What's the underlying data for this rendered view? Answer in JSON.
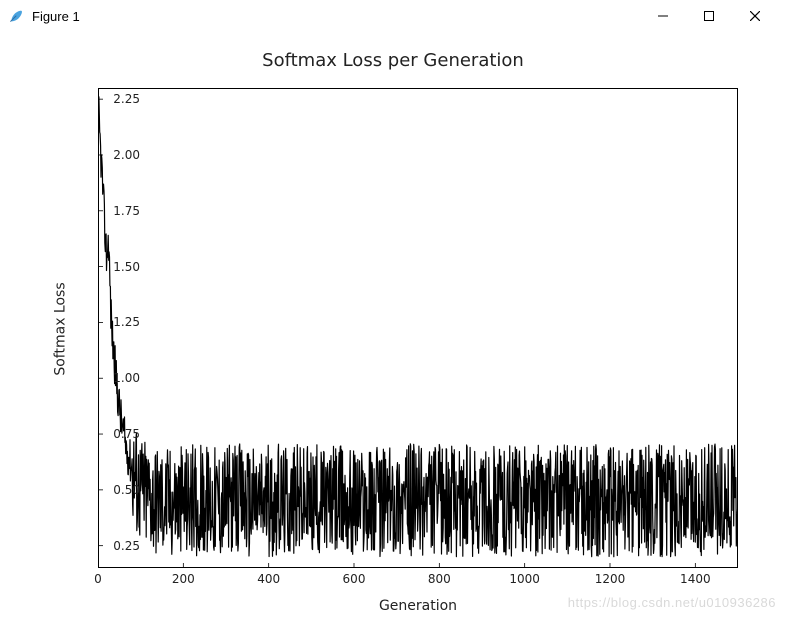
{
  "window": {
    "title": "Figure 1",
    "icon": "feather-icon",
    "buttons": {
      "minimize": "—",
      "maximize": "▢",
      "close": "✕"
    }
  },
  "watermark": "https://blog.csdn.net/u010936286",
  "chart_data": {
    "type": "line",
    "title": "Softmax Loss per Generation",
    "xlabel": "Generation",
    "ylabel": "Softmax Loss",
    "xlim": [
      0,
      1500
    ],
    "ylim": [
      0.15,
      2.3
    ],
    "xticks": [
      0,
      200,
      400,
      600,
      800,
      1000,
      1200,
      1400
    ],
    "yticks": [
      0.25,
      0.5,
      0.75,
      1.0,
      1.25,
      1.5,
      1.75,
      2.0,
      2.25
    ],
    "series": [
      {
        "name": "loss",
        "color": "#000000",
        "x_start": 0,
        "x_step": 1,
        "values_summary": "1500 per-generation loss values: starts ~2.25, drops steeply to ~0.5 by gen≈80, then noisy plateau 0.2–0.75 to gen 1500",
        "key_points": [
          {
            "x": 0,
            "y": 2.25
          },
          {
            "x": 5,
            "y": 2.05
          },
          {
            "x": 10,
            "y": 1.9
          },
          {
            "x": 15,
            "y": 1.7
          },
          {
            "x": 20,
            "y": 1.55
          },
          {
            "x": 25,
            "y": 1.62
          },
          {
            "x": 30,
            "y": 1.3
          },
          {
            "x": 35,
            "y": 1.15
          },
          {
            "x": 40,
            "y": 1.05
          },
          {
            "x": 45,
            "y": 0.95
          },
          {
            "x": 55,
            "y": 0.8
          },
          {
            "x": 65,
            "y": 0.7
          },
          {
            "x": 80,
            "y": 0.6
          },
          {
            "x": 100,
            "y": 0.5
          },
          {
            "x": 150,
            "y": 0.45
          },
          {
            "x": 200,
            "y": 0.45
          },
          {
            "x": 400,
            "y": 0.45
          },
          {
            "x": 600,
            "y": 0.45
          },
          {
            "x": 800,
            "y": 0.45
          },
          {
            "x": 1000,
            "y": 0.45
          },
          {
            "x": 1200,
            "y": 0.45
          },
          {
            "x": 1400,
            "y": 0.45
          },
          {
            "x": 1500,
            "y": 0.45
          }
        ],
        "plateau_noise": {
          "min": 0.2,
          "max": 0.77,
          "mean": 0.45
        }
      }
    ]
  }
}
